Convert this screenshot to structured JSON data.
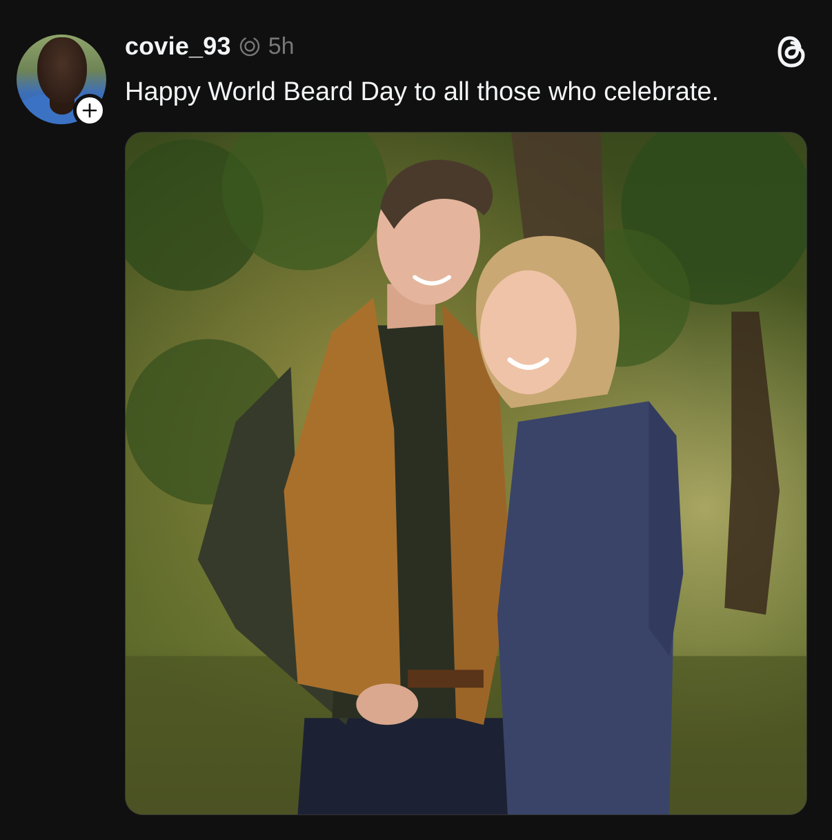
{
  "post": {
    "username": "covie_93",
    "timestamp": "5h",
    "caption": "Happy World Beard Day to all those who celebrate."
  },
  "icons": {
    "follow": "plus-icon",
    "recent_activity": "recent-activity-icon",
    "app_logo": "threads-logo-icon"
  },
  "colors": {
    "background": "#101010",
    "text_primary": "#f3f5f7",
    "text_secondary": "#777777"
  }
}
